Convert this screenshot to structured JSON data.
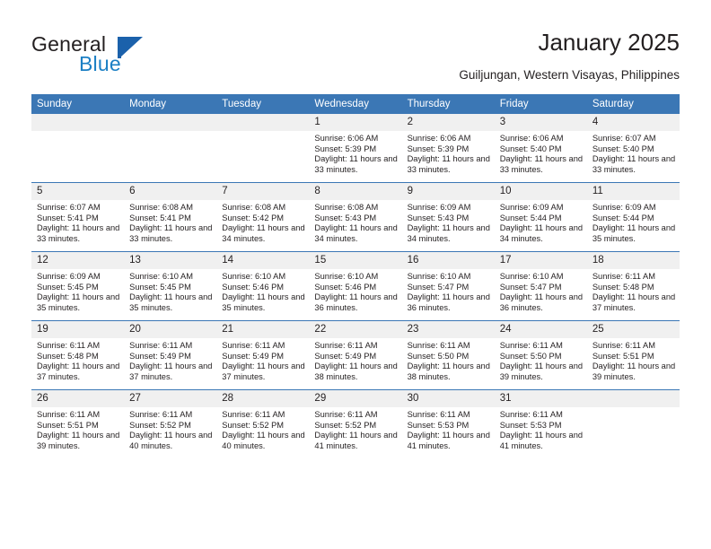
{
  "brand": {
    "name_part1": "General",
    "name_part2": "Blue",
    "accent_color": "#1b7fc4",
    "flag_color": "#1b61ab"
  },
  "header": {
    "title": "January 2025",
    "subtitle": "Guiljungan, Western Visayas, Philippines"
  },
  "theme": {
    "header_blue": "#3b77b5",
    "daynum_band": "#f0f0f0",
    "text": "#231f20"
  },
  "weekdays": [
    "Sunday",
    "Monday",
    "Tuesday",
    "Wednesday",
    "Thursday",
    "Friday",
    "Saturday"
  ],
  "weeks": [
    [
      {
        "day": "",
        "empty": true
      },
      {
        "day": "",
        "empty": true
      },
      {
        "day": "",
        "empty": true
      },
      {
        "day": "1",
        "sunrise": "Sunrise: 6:06 AM",
        "sunset": "Sunset: 5:39 PM",
        "daylight": "Daylight: 11 hours and 33 minutes."
      },
      {
        "day": "2",
        "sunrise": "Sunrise: 6:06 AM",
        "sunset": "Sunset: 5:39 PM",
        "daylight": "Daylight: 11 hours and 33 minutes."
      },
      {
        "day": "3",
        "sunrise": "Sunrise: 6:06 AM",
        "sunset": "Sunset: 5:40 PM",
        "daylight": "Daylight: 11 hours and 33 minutes."
      },
      {
        "day": "4",
        "sunrise": "Sunrise: 6:07 AM",
        "sunset": "Sunset: 5:40 PM",
        "daylight": "Daylight: 11 hours and 33 minutes."
      }
    ],
    [
      {
        "day": "5",
        "sunrise": "Sunrise: 6:07 AM",
        "sunset": "Sunset: 5:41 PM",
        "daylight": "Daylight: 11 hours and 33 minutes."
      },
      {
        "day": "6",
        "sunrise": "Sunrise: 6:08 AM",
        "sunset": "Sunset: 5:41 PM",
        "daylight": "Daylight: 11 hours and 33 minutes."
      },
      {
        "day": "7",
        "sunrise": "Sunrise: 6:08 AM",
        "sunset": "Sunset: 5:42 PM",
        "daylight": "Daylight: 11 hours and 34 minutes."
      },
      {
        "day": "8",
        "sunrise": "Sunrise: 6:08 AM",
        "sunset": "Sunset: 5:43 PM",
        "daylight": "Daylight: 11 hours and 34 minutes."
      },
      {
        "day": "9",
        "sunrise": "Sunrise: 6:09 AM",
        "sunset": "Sunset: 5:43 PM",
        "daylight": "Daylight: 11 hours and 34 minutes."
      },
      {
        "day": "10",
        "sunrise": "Sunrise: 6:09 AM",
        "sunset": "Sunset: 5:44 PM",
        "daylight": "Daylight: 11 hours and 34 minutes."
      },
      {
        "day": "11",
        "sunrise": "Sunrise: 6:09 AM",
        "sunset": "Sunset: 5:44 PM",
        "daylight": "Daylight: 11 hours and 35 minutes."
      }
    ],
    [
      {
        "day": "12",
        "sunrise": "Sunrise: 6:09 AM",
        "sunset": "Sunset: 5:45 PM",
        "daylight": "Daylight: 11 hours and 35 minutes."
      },
      {
        "day": "13",
        "sunrise": "Sunrise: 6:10 AM",
        "sunset": "Sunset: 5:45 PM",
        "daylight": "Daylight: 11 hours and 35 minutes."
      },
      {
        "day": "14",
        "sunrise": "Sunrise: 6:10 AM",
        "sunset": "Sunset: 5:46 PM",
        "daylight": "Daylight: 11 hours and 35 minutes."
      },
      {
        "day": "15",
        "sunrise": "Sunrise: 6:10 AM",
        "sunset": "Sunset: 5:46 PM",
        "daylight": "Daylight: 11 hours and 36 minutes."
      },
      {
        "day": "16",
        "sunrise": "Sunrise: 6:10 AM",
        "sunset": "Sunset: 5:47 PM",
        "daylight": "Daylight: 11 hours and 36 minutes."
      },
      {
        "day": "17",
        "sunrise": "Sunrise: 6:10 AM",
        "sunset": "Sunset: 5:47 PM",
        "daylight": "Daylight: 11 hours and 36 minutes."
      },
      {
        "day": "18",
        "sunrise": "Sunrise: 6:11 AM",
        "sunset": "Sunset: 5:48 PM",
        "daylight": "Daylight: 11 hours and 37 minutes."
      }
    ],
    [
      {
        "day": "19",
        "sunrise": "Sunrise: 6:11 AM",
        "sunset": "Sunset: 5:48 PM",
        "daylight": "Daylight: 11 hours and 37 minutes."
      },
      {
        "day": "20",
        "sunrise": "Sunrise: 6:11 AM",
        "sunset": "Sunset: 5:49 PM",
        "daylight": "Daylight: 11 hours and 37 minutes."
      },
      {
        "day": "21",
        "sunrise": "Sunrise: 6:11 AM",
        "sunset": "Sunset: 5:49 PM",
        "daylight": "Daylight: 11 hours and 37 minutes."
      },
      {
        "day": "22",
        "sunrise": "Sunrise: 6:11 AM",
        "sunset": "Sunset: 5:49 PM",
        "daylight": "Daylight: 11 hours and 38 minutes."
      },
      {
        "day": "23",
        "sunrise": "Sunrise: 6:11 AM",
        "sunset": "Sunset: 5:50 PM",
        "daylight": "Daylight: 11 hours and 38 minutes."
      },
      {
        "day": "24",
        "sunrise": "Sunrise: 6:11 AM",
        "sunset": "Sunset: 5:50 PM",
        "daylight": "Daylight: 11 hours and 39 minutes."
      },
      {
        "day": "25",
        "sunrise": "Sunrise: 6:11 AM",
        "sunset": "Sunset: 5:51 PM",
        "daylight": "Daylight: 11 hours and 39 minutes."
      }
    ],
    [
      {
        "day": "26",
        "sunrise": "Sunrise: 6:11 AM",
        "sunset": "Sunset: 5:51 PM",
        "daylight": "Daylight: 11 hours and 39 minutes."
      },
      {
        "day": "27",
        "sunrise": "Sunrise: 6:11 AM",
        "sunset": "Sunset: 5:52 PM",
        "daylight": "Daylight: 11 hours and 40 minutes."
      },
      {
        "day": "28",
        "sunrise": "Sunrise: 6:11 AM",
        "sunset": "Sunset: 5:52 PM",
        "daylight": "Daylight: 11 hours and 40 minutes."
      },
      {
        "day": "29",
        "sunrise": "Sunrise: 6:11 AM",
        "sunset": "Sunset: 5:52 PM",
        "daylight": "Daylight: 11 hours and 41 minutes."
      },
      {
        "day": "30",
        "sunrise": "Sunrise: 6:11 AM",
        "sunset": "Sunset: 5:53 PM",
        "daylight": "Daylight: 11 hours and 41 minutes."
      },
      {
        "day": "31",
        "sunrise": "Sunrise: 6:11 AM",
        "sunset": "Sunset: 5:53 PM",
        "daylight": "Daylight: 11 hours and 41 minutes."
      },
      {
        "day": "",
        "empty": true
      }
    ]
  ]
}
